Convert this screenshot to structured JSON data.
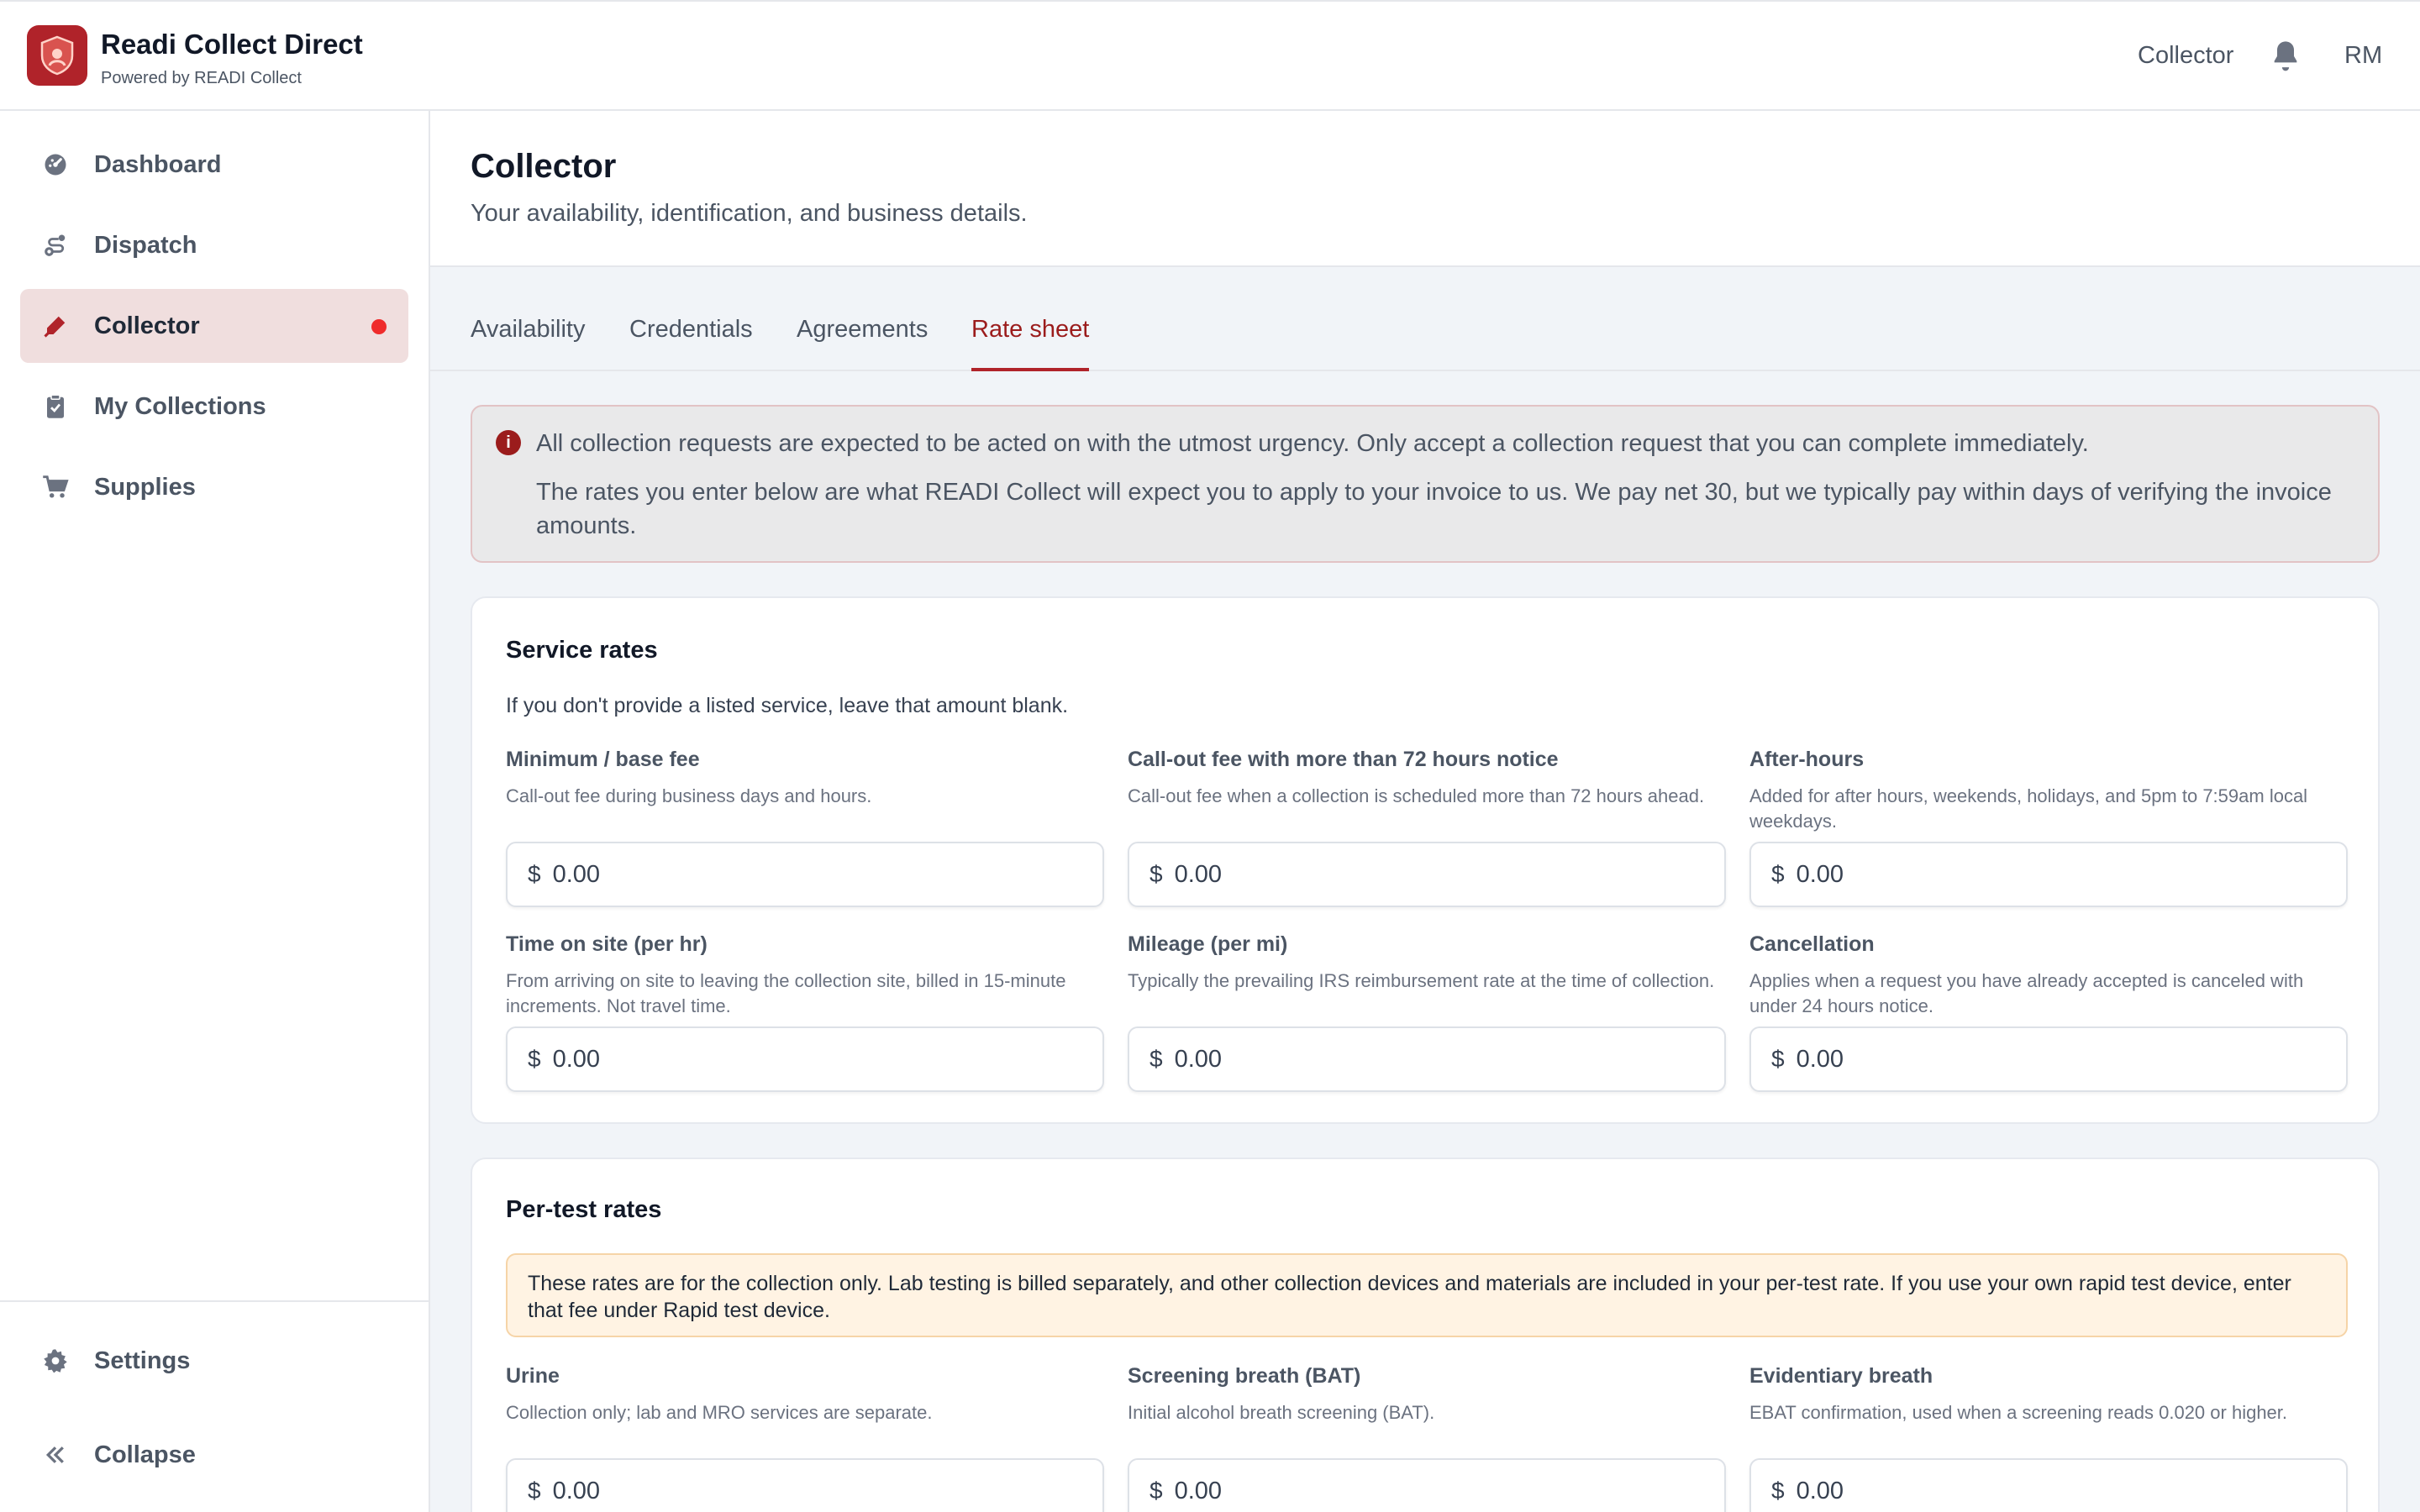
{
  "brand": {
    "title": "Readi Collect Direct",
    "subtitle": "Powered by READI Collect"
  },
  "topbar": {
    "role": "Collector",
    "initials": "RM"
  },
  "sidebar": {
    "items": [
      {
        "label": "Dashboard",
        "icon": "dashboard-icon"
      },
      {
        "label": "Dispatch",
        "icon": "dispatch-icon"
      },
      {
        "label": "Collector",
        "icon": "pen-icon",
        "active": true
      },
      {
        "label": "My Collections",
        "icon": "clipboard-icon"
      },
      {
        "label": "Supplies",
        "icon": "cart-icon"
      }
    ],
    "bottom": [
      {
        "label": "Settings",
        "icon": "gear-icon"
      },
      {
        "label": "Collapse",
        "icon": "chevrons-left-icon"
      }
    ]
  },
  "page": {
    "title": "Collector",
    "subtitle": "Your availability, identification, and business details."
  },
  "tabs": [
    {
      "label": "Availability"
    },
    {
      "label": "Credentials"
    },
    {
      "label": "Agreements"
    },
    {
      "label": "Rate sheet",
      "active": true
    }
  ],
  "alert": {
    "line1": "All collection requests are expected to be acted on with the utmost urgency. Only accept a collection request that you can complete immediately.",
    "line2": "The rates you enter below are what READI Collect will expect you to apply to your invoice to us. We pay net 30, but we typically pay within days of verifying the invoice amounts."
  },
  "service_rates": {
    "title": "Service rates",
    "description": "If you don't provide a listed service, leave that amount blank.",
    "currency_symbol": "$",
    "placeholder": "0.00",
    "fields": [
      {
        "label": "Minimum / base fee",
        "help": "Call-out fee during business days and hours."
      },
      {
        "label": "Call-out fee with more than 72 hours notice",
        "help": "Call-out fee when a collection is scheduled more than 72 hours ahead."
      },
      {
        "label": "After-hours",
        "help": "Added for after hours, weekends, holidays, and 5pm to 7:59am local weekdays."
      },
      {
        "label": "Time on site (per hr)",
        "help": "From arriving on site to leaving the collection site, billed in 15-minute increments. Not travel time."
      },
      {
        "label": "Mileage (per mi)",
        "help": "Typically the prevailing IRS reimbursement rate at the time of collection."
      },
      {
        "label": "Cancellation",
        "help": "Applies when a request you have already accepted is canceled with under 24 hours notice."
      }
    ]
  },
  "per_test_rates": {
    "title": "Per-test rates",
    "notice": "These rates are for the collection only. Lab testing is billed separately, and other collection devices and materials are included in your per-test rate. If you use your own rapid test device, enter that fee under Rapid test device.",
    "currency_symbol": "$",
    "placeholder": "0.00",
    "fields": [
      {
        "label": "Urine",
        "help": "Collection only; lab and MRO services are separate."
      },
      {
        "label": "Screening breath (BAT)",
        "help": "Initial alcohol breath screening (BAT)."
      },
      {
        "label": "Evidentiary breath",
        "help": "EBAT confirmation, used when a screening reads 0.020 or higher."
      }
    ]
  },
  "colors": {
    "brand": "#b0232a",
    "active_nav_bg": "#f0dede",
    "notification_dot": "#ef2b2b",
    "alert_bg": "#e9e9ea",
    "notice_bg": "#fff3e3"
  }
}
